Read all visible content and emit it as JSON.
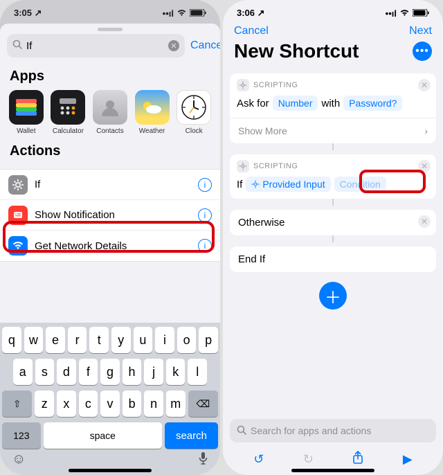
{
  "left": {
    "status": {
      "time": "3:05",
      "loc": "↗"
    },
    "search": {
      "value": "If",
      "cancel": "Cancel"
    },
    "apps_header": "Apps",
    "apps": [
      {
        "name": "Wallet"
      },
      {
        "name": "Calculator"
      },
      {
        "name": "Contacts"
      },
      {
        "name": "Weather"
      },
      {
        "name": "Clock"
      }
    ],
    "actions_header": "Actions",
    "actions": [
      {
        "label": "If"
      },
      {
        "label": "Show Notification"
      },
      {
        "label": "Get Network Details"
      }
    ],
    "keyboard": {
      "row1": [
        "q",
        "w",
        "e",
        "r",
        "t",
        "y",
        "u",
        "i",
        "o",
        "p"
      ],
      "row2": [
        "a",
        "s",
        "d",
        "f",
        "g",
        "h",
        "j",
        "k",
        "l"
      ],
      "row3": [
        "z",
        "x",
        "c",
        "v",
        "b",
        "n",
        "m"
      ],
      "num": "123",
      "space": "space",
      "search": "search"
    }
  },
  "right": {
    "status": {
      "time": "3:06",
      "loc": "↗"
    },
    "nav": {
      "cancel": "Cancel",
      "next": "Next"
    },
    "title": "New Shortcut",
    "scripting_label": "SCRIPTING",
    "ask": {
      "text1": "Ask for",
      "token1": "Number",
      "text2": "with",
      "token2": "Password?"
    },
    "showmore": "Show More",
    "ifrow": {
      "if": "If",
      "input_token": "Provided Input",
      "cond_token": "Condition"
    },
    "otherwise": "Otherwise",
    "endif": "End If",
    "bottom_search_placeholder": "Search for apps and actions"
  }
}
